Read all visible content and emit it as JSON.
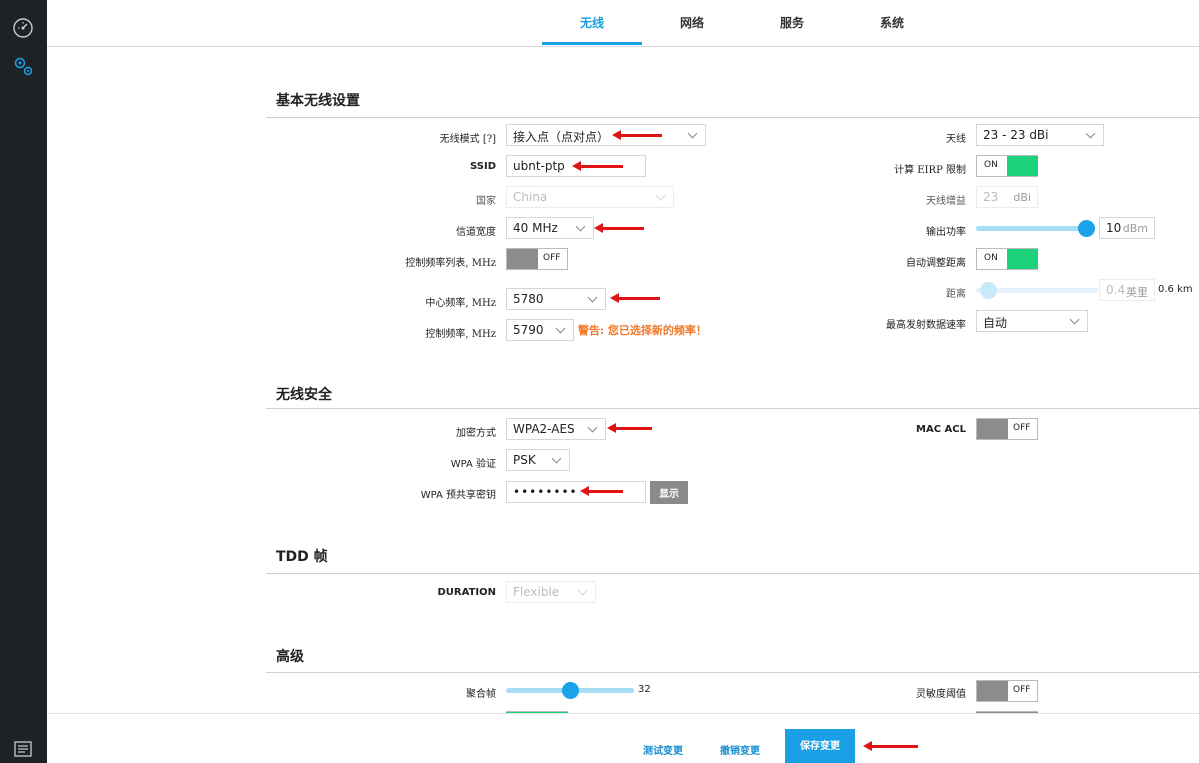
{
  "nav": {
    "tabs": [
      "无线",
      "网络",
      "服务",
      "系统"
    ],
    "active_tab": "无线"
  },
  "basic": {
    "title": "基本无线设置",
    "wireless_mode_label": "无线模式 [?]",
    "wireless_mode": "接入点（点对点）",
    "ssid_label": "SSID",
    "ssid": "ubnt-ptp",
    "country_label": "国家",
    "country": "China",
    "channel_width_label": "信道宽度",
    "channel_width": "40 MHz",
    "ctrl_freq_list_label": "控制频率列表, MHz",
    "ctrl_freq_list_toggle": "OFF",
    "center_freq_label": "中心频率, MHz",
    "center_freq": "5780",
    "ctrl_freq_label": "控制频率, MHz",
    "ctrl_freq": "5790",
    "warning": "警告: 您已选择新的频率！",
    "antenna_label": "天线",
    "antenna": "23 - 23 dBi",
    "eirp_label": "计算 EIRP 限制",
    "eirp_toggle": "ON",
    "antenna_gain_label": "天线增益",
    "antenna_gain": "23",
    "antenna_gain_unit": "dBi",
    "output_power_label": "输出功率",
    "output_power": "10",
    "output_power_unit": "dBm",
    "auto_distance_label": "自动调整距离",
    "auto_distance_toggle": "ON",
    "distance_label": "距离",
    "distance": "0.4",
    "distance_unit": "英里",
    "distance_km": "0.6 km",
    "max_rate_label": "最高发射数据速率",
    "max_rate": "自动"
  },
  "security": {
    "title": "无线安全",
    "encryption_label": "加密方式",
    "encryption": "WPA2-AES",
    "wpa_auth_label": "WPA 验证",
    "wpa_auth": "PSK",
    "psk_label": "WPA 预共享密钥",
    "psk": "••••••••",
    "show_button": "显示",
    "mac_acl_label": "MAC ACL",
    "mac_acl_toggle": "OFF"
  },
  "tdd": {
    "title": "TDD 帧",
    "duration_label": "DURATION",
    "duration": "Flexible"
  },
  "advanced": {
    "title": "高级",
    "aggregation_label": "聚合帧",
    "aggregation": "32",
    "sensitivity_label": "灵敏度阈值",
    "sensitivity_toggle": "OFF"
  },
  "footer": {
    "test_label": "测试变更",
    "discard_label": "撤销变更",
    "save_label": "保存变更"
  },
  "colors": {
    "accent": "#1a9fe0",
    "toggle_on": "#1dd27a",
    "toggle_off": "#8c8c8c",
    "warning": "#f07a2c",
    "annotation_arrow": "#e01414",
    "sidebar": "#1c2226"
  }
}
